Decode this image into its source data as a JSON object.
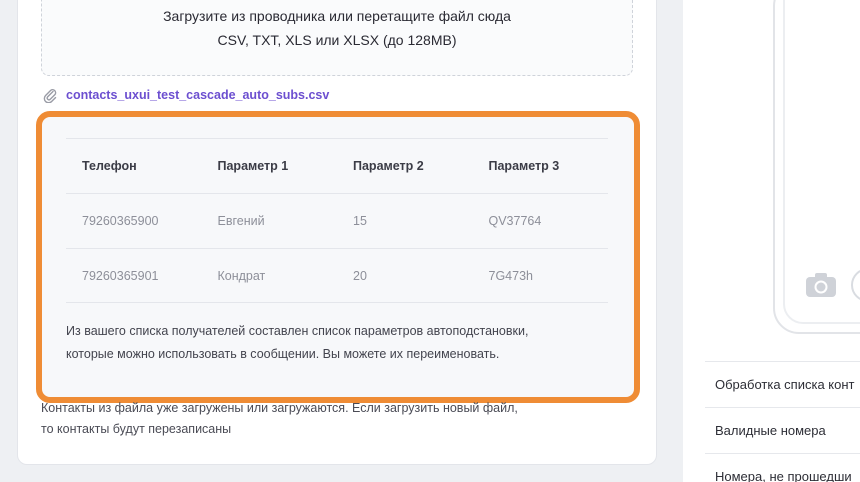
{
  "upload": {
    "instruction": "Загрузите из проводника или перетащите файл сюда",
    "formats": "CSV, TXT, XLS или XLSX (до 128MB)"
  },
  "file": {
    "icon": "paperclip-icon",
    "name": "contacts_uxui_test_cascade_auto_subs.csv"
  },
  "preview": {
    "highlight_color": "#ef8c35",
    "columns": [
      "Телефон",
      "Параметр 1",
      "Параметр 2",
      "Параметр 3"
    ],
    "rows": [
      [
        "79260365900",
        "Евгений",
        "15",
        "QV37764"
      ],
      [
        "79260365901",
        "Кондрат",
        "20",
        "7G473h"
      ]
    ],
    "note_line1": "Из вашего списка получателей составлен список параметров автоподстановки,",
    "note_line2": "которые можно использовать в сообщении. Вы можете их переименовать."
  },
  "warning": {
    "line1": "Контакты из файла уже загружены или загружаются. Если загрузить новый файл,",
    "line2": "то контакты будут перезаписаны"
  },
  "sidebar": {
    "camera_icon": "camera-icon",
    "items": [
      "Обработка списка конт",
      "Валидные номера",
      "Номера, не прошедши"
    ]
  }
}
